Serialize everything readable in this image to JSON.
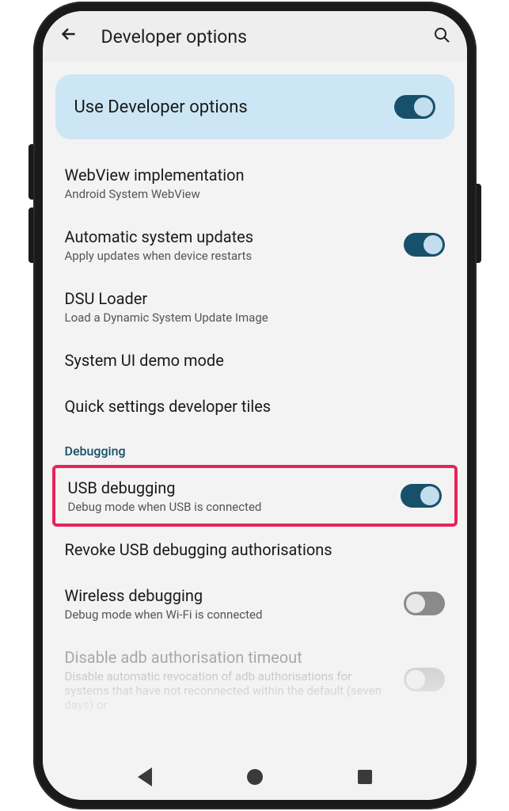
{
  "header": {
    "title": "Developer options"
  },
  "banner": {
    "title": "Use Developer options",
    "toggle_on": true
  },
  "settings": [
    {
      "title": "WebView implementation",
      "subtitle": "Android System WebView",
      "toggle": null
    },
    {
      "title": "Automatic system updates",
      "subtitle": "Apply updates when device restarts",
      "toggle": true
    },
    {
      "title": "DSU Loader",
      "subtitle": "Load a Dynamic System Update Image",
      "toggle": null
    },
    {
      "title": "System UI demo mode",
      "subtitle": "",
      "toggle": null
    },
    {
      "title": "Quick settings developer tiles",
      "subtitle": "",
      "toggle": null
    }
  ],
  "section": {
    "label": "Debugging"
  },
  "debug_settings": [
    {
      "title": "USB debugging",
      "subtitle": "Debug mode when USB is connected",
      "toggle": true,
      "highlighted": true
    },
    {
      "title": "Revoke USB debugging authorisations",
      "subtitle": "",
      "toggle": null
    },
    {
      "title": "Wireless debugging",
      "subtitle": "Debug mode when Wi-Fi is connected",
      "toggle": false
    },
    {
      "title": "Disable adb authorisation timeout",
      "subtitle": "Disable automatic revocation of adb authorisations for systems that have not reconnected within the default (seven days) or",
      "toggle": false
    }
  ]
}
